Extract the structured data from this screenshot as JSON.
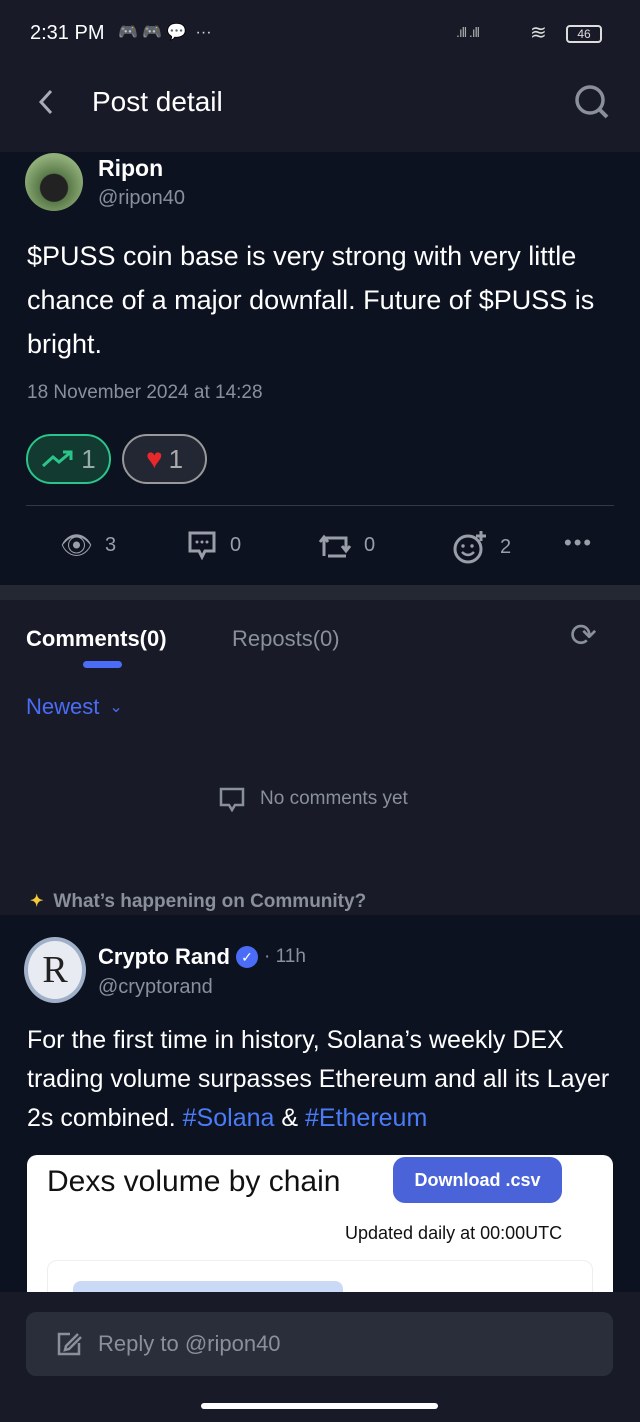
{
  "status_bar": {
    "time": "2:31 PM",
    "battery": "46"
  },
  "header": {
    "title": "Post detail"
  },
  "post": {
    "author": "Ripon",
    "handle": "@ripon40",
    "text": "$PUSS coin base is very strong with very little chance of a major downfall. Future of $PUSS is bright.",
    "timestamp": "18 November 2024 at 14:28",
    "reactions": {
      "bullish": "1",
      "heart": "1"
    },
    "stats": {
      "views": "3",
      "comments": "0",
      "reposts": "0",
      "emoji_reactions": "2"
    }
  },
  "tabs": {
    "comments": "Comments(0)",
    "reposts": "Reposts(0)"
  },
  "sort": {
    "label": "Newest"
  },
  "empty_state": "No comments yet",
  "community_label": "What’s happening on Community?",
  "feed_post": {
    "author": "Crypto Rand",
    "time": "· 11h",
    "handle": "@cryptorand",
    "text": "For the first time in history, Solana’s weekly DEX trading volume surpasses Ethereum and all its Layer 2s combined.",
    "tag1": "#Solana",
    "amp": "&",
    "tag2": "#Ethereum",
    "image": {
      "title": "Dexs volume by chain",
      "button": "Download .csv",
      "subtitle": "Updated daily at 00:00UTC"
    }
  },
  "reply": {
    "placeholder": "Reply to @ripon40"
  },
  "colors": {
    "accent": "#4a6cf7",
    "bullish": "#2bc48a",
    "heart": "#e8282b"
  }
}
